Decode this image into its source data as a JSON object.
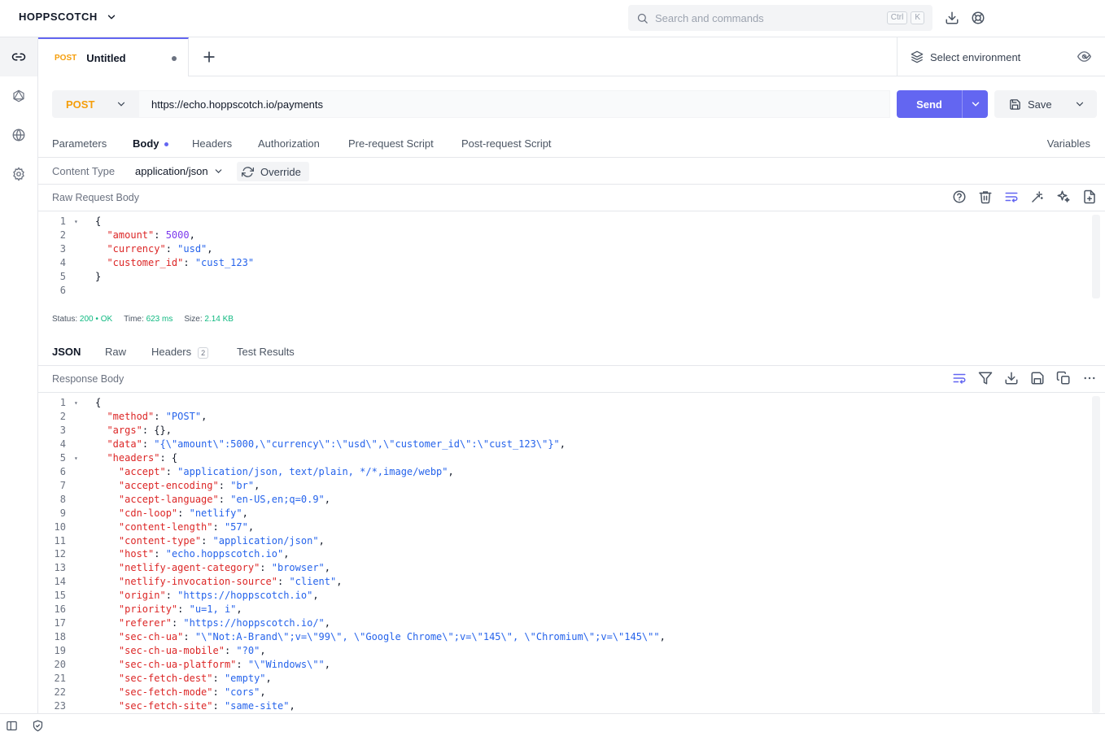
{
  "app": {
    "brand": "HOPPSCOTCH",
    "search_placeholder": "Search and commands",
    "search_shortcut": [
      "Ctrl",
      "K"
    ]
  },
  "tab": {
    "method": "POST",
    "title": "Untitled"
  },
  "environment": {
    "label": "Select environment"
  },
  "request": {
    "method": "POST",
    "url": "https://echo.hoppscotch.io/payments",
    "send_label": "Send",
    "save_label": "Save"
  },
  "request_tabs": [
    "Parameters",
    "Body",
    "Headers",
    "Authorization",
    "Pre-request Script",
    "Post-request Script"
  ],
  "variables_label": "Variables",
  "content_type": {
    "label": "Content Type",
    "value": "application/json",
    "override_label": "Override"
  },
  "raw_body": {
    "label": "Raw Request Body",
    "lines": [
      {
        "n": "1",
        "fold": true,
        "parts": [
          {
            "t": "{",
            "c": ""
          }
        ]
      },
      {
        "n": "2",
        "fold": false,
        "parts": [
          {
            "t": "  ",
            "c": ""
          },
          {
            "t": "\"amount\"",
            "c": "k"
          },
          {
            "t": ": ",
            "c": ""
          },
          {
            "t": "5000",
            "c": "n"
          },
          {
            "t": ",",
            "c": ""
          }
        ]
      },
      {
        "n": "3",
        "fold": false,
        "parts": [
          {
            "t": "  ",
            "c": ""
          },
          {
            "t": "\"currency\"",
            "c": "k"
          },
          {
            "t": ": ",
            "c": ""
          },
          {
            "t": "\"usd\"",
            "c": "s"
          },
          {
            "t": ",",
            "c": ""
          }
        ]
      },
      {
        "n": "4",
        "fold": false,
        "parts": [
          {
            "t": "  ",
            "c": ""
          },
          {
            "t": "\"customer_id\"",
            "c": "k"
          },
          {
            "t": ": ",
            "c": ""
          },
          {
            "t": "\"cust_123\"",
            "c": "s"
          }
        ]
      },
      {
        "n": "5",
        "fold": false,
        "parts": [
          {
            "t": "}",
            "c": ""
          }
        ]
      },
      {
        "n": "6",
        "fold": false,
        "parts": []
      }
    ]
  },
  "status": {
    "status_label": "Status:",
    "status_code": "200",
    "status_text": "OK",
    "time_label": "Time:",
    "time_value": "623 ms",
    "size_label": "Size:",
    "size_value": "2.14 KB"
  },
  "response_tabs": [
    {
      "label": "JSON",
      "badge": ""
    },
    {
      "label": "Raw",
      "badge": ""
    },
    {
      "label": "Headers",
      "badge": "2"
    },
    {
      "label": "Test Results",
      "badge": ""
    }
  ],
  "response_body": {
    "label": "Response Body",
    "lines": [
      {
        "n": "1",
        "fold": true,
        "parts": [
          {
            "t": "{",
            "c": ""
          }
        ]
      },
      {
        "n": "2",
        "fold": false,
        "parts": [
          {
            "t": "  ",
            "c": ""
          },
          {
            "t": "\"method\"",
            "c": "k"
          },
          {
            "t": ": ",
            "c": ""
          },
          {
            "t": "\"POST\"",
            "c": "s"
          },
          {
            "t": ",",
            "c": ""
          }
        ]
      },
      {
        "n": "3",
        "fold": false,
        "parts": [
          {
            "t": "  ",
            "c": ""
          },
          {
            "t": "\"args\"",
            "c": "k"
          },
          {
            "t": ": {},",
            "c": ""
          }
        ]
      },
      {
        "n": "4",
        "fold": false,
        "parts": [
          {
            "t": "  ",
            "c": ""
          },
          {
            "t": "\"data\"",
            "c": "k"
          },
          {
            "t": ": ",
            "c": ""
          },
          {
            "t": "\"{\\\"amount\\\":5000,\\\"currency\\\":\\\"usd\\\",\\\"customer_id\\\":\\\"cust_123\\\"}\"",
            "c": "s"
          },
          {
            "t": ",",
            "c": ""
          }
        ]
      },
      {
        "n": "5",
        "fold": true,
        "parts": [
          {
            "t": "  ",
            "c": ""
          },
          {
            "t": "\"headers\"",
            "c": "k"
          },
          {
            "t": ": {",
            "c": ""
          }
        ]
      },
      {
        "n": "6",
        "fold": false,
        "parts": [
          {
            "t": "    ",
            "c": ""
          },
          {
            "t": "\"accept\"",
            "c": "k"
          },
          {
            "t": ": ",
            "c": ""
          },
          {
            "t": "\"application/json, text/plain, */*,image/webp\"",
            "c": "s"
          },
          {
            "t": ",",
            "c": ""
          }
        ]
      },
      {
        "n": "7",
        "fold": false,
        "parts": [
          {
            "t": "    ",
            "c": ""
          },
          {
            "t": "\"accept-encoding\"",
            "c": "k"
          },
          {
            "t": ": ",
            "c": ""
          },
          {
            "t": "\"br\"",
            "c": "s"
          },
          {
            "t": ",",
            "c": ""
          }
        ]
      },
      {
        "n": "8",
        "fold": false,
        "parts": [
          {
            "t": "    ",
            "c": ""
          },
          {
            "t": "\"accept-language\"",
            "c": "k"
          },
          {
            "t": ": ",
            "c": ""
          },
          {
            "t": "\"en-US,en;q=0.9\"",
            "c": "s"
          },
          {
            "t": ",",
            "c": ""
          }
        ]
      },
      {
        "n": "9",
        "fold": false,
        "parts": [
          {
            "t": "    ",
            "c": ""
          },
          {
            "t": "\"cdn-loop\"",
            "c": "k"
          },
          {
            "t": ": ",
            "c": ""
          },
          {
            "t": "\"netlify\"",
            "c": "s"
          },
          {
            "t": ",",
            "c": ""
          }
        ]
      },
      {
        "n": "10",
        "fold": false,
        "parts": [
          {
            "t": "    ",
            "c": ""
          },
          {
            "t": "\"content-length\"",
            "c": "k"
          },
          {
            "t": ": ",
            "c": ""
          },
          {
            "t": "\"57\"",
            "c": "s"
          },
          {
            "t": ",",
            "c": ""
          }
        ]
      },
      {
        "n": "11",
        "fold": false,
        "parts": [
          {
            "t": "    ",
            "c": ""
          },
          {
            "t": "\"content-type\"",
            "c": "k"
          },
          {
            "t": ": ",
            "c": ""
          },
          {
            "t": "\"application/json\"",
            "c": "s"
          },
          {
            "t": ",",
            "c": ""
          }
        ]
      },
      {
        "n": "12",
        "fold": false,
        "parts": [
          {
            "t": "    ",
            "c": ""
          },
          {
            "t": "\"host\"",
            "c": "k"
          },
          {
            "t": ": ",
            "c": ""
          },
          {
            "t": "\"echo.hoppscotch.io\"",
            "c": "s"
          },
          {
            "t": ",",
            "c": ""
          }
        ]
      },
      {
        "n": "13",
        "fold": false,
        "parts": [
          {
            "t": "    ",
            "c": ""
          },
          {
            "t": "\"netlify-agent-category\"",
            "c": "k"
          },
          {
            "t": ": ",
            "c": ""
          },
          {
            "t": "\"browser\"",
            "c": "s"
          },
          {
            "t": ",",
            "c": ""
          }
        ]
      },
      {
        "n": "14",
        "fold": false,
        "parts": [
          {
            "t": "    ",
            "c": ""
          },
          {
            "t": "\"netlify-invocation-source\"",
            "c": "k"
          },
          {
            "t": ": ",
            "c": ""
          },
          {
            "t": "\"client\"",
            "c": "s"
          },
          {
            "t": ",",
            "c": ""
          }
        ]
      },
      {
        "n": "15",
        "fold": false,
        "parts": [
          {
            "t": "    ",
            "c": ""
          },
          {
            "t": "\"origin\"",
            "c": "k"
          },
          {
            "t": ": ",
            "c": ""
          },
          {
            "t": "\"https://hoppscotch.io\"",
            "c": "s"
          },
          {
            "t": ",",
            "c": ""
          }
        ]
      },
      {
        "n": "16",
        "fold": false,
        "parts": [
          {
            "t": "    ",
            "c": ""
          },
          {
            "t": "\"priority\"",
            "c": "k"
          },
          {
            "t": ": ",
            "c": ""
          },
          {
            "t": "\"u=1, i\"",
            "c": "s"
          },
          {
            "t": ",",
            "c": ""
          }
        ]
      },
      {
        "n": "17",
        "fold": false,
        "parts": [
          {
            "t": "    ",
            "c": ""
          },
          {
            "t": "\"referer\"",
            "c": "k"
          },
          {
            "t": ": ",
            "c": ""
          },
          {
            "t": "\"https://hoppscotch.io/\"",
            "c": "s"
          },
          {
            "t": ",",
            "c": ""
          }
        ]
      },
      {
        "n": "18",
        "fold": false,
        "parts": [
          {
            "t": "    ",
            "c": ""
          },
          {
            "t": "\"sec-ch-ua\"",
            "c": "k"
          },
          {
            "t": ": ",
            "c": ""
          },
          {
            "t": "\"\\\"Not:A-Brand\\\";v=\\\"99\\\", \\\"Google Chrome\\\";v=\\\"145\\\", \\\"Chromium\\\";v=\\\"145\\\"\"",
            "c": "s"
          },
          {
            "t": ",",
            "c": ""
          }
        ]
      },
      {
        "n": "19",
        "fold": false,
        "parts": [
          {
            "t": "    ",
            "c": ""
          },
          {
            "t": "\"sec-ch-ua-mobile\"",
            "c": "k"
          },
          {
            "t": ": ",
            "c": ""
          },
          {
            "t": "\"?0\"",
            "c": "s"
          },
          {
            "t": ",",
            "c": ""
          }
        ]
      },
      {
        "n": "20",
        "fold": false,
        "parts": [
          {
            "t": "    ",
            "c": ""
          },
          {
            "t": "\"sec-ch-ua-platform\"",
            "c": "k"
          },
          {
            "t": ": ",
            "c": ""
          },
          {
            "t": "\"\\\"Windows\\\"\"",
            "c": "s"
          },
          {
            "t": ",",
            "c": ""
          }
        ]
      },
      {
        "n": "21",
        "fold": false,
        "parts": [
          {
            "t": "    ",
            "c": ""
          },
          {
            "t": "\"sec-fetch-dest\"",
            "c": "k"
          },
          {
            "t": ": ",
            "c": ""
          },
          {
            "t": "\"empty\"",
            "c": "s"
          },
          {
            "t": ",",
            "c": ""
          }
        ]
      },
      {
        "n": "22",
        "fold": false,
        "parts": [
          {
            "t": "    ",
            "c": ""
          },
          {
            "t": "\"sec-fetch-mode\"",
            "c": "k"
          },
          {
            "t": ": ",
            "c": ""
          },
          {
            "t": "\"cors\"",
            "c": "s"
          },
          {
            "t": ",",
            "c": ""
          }
        ]
      },
      {
        "n": "23",
        "fold": false,
        "parts": [
          {
            "t": "    ",
            "c": ""
          },
          {
            "t": "\"sec-fetch-site\"",
            "c": "k"
          },
          {
            "t": ": ",
            "c": ""
          },
          {
            "t": "\"same-site\"",
            "c": "s"
          },
          {
            "t": ",",
            "c": ""
          }
        ]
      }
    ]
  },
  "colors": {
    "accent": "#6366f1",
    "method_post": "#f59e0b",
    "status_ok": "#10b981",
    "json_key": "#dc2626",
    "json_string": "#2563eb",
    "json_number": "#7c3aed"
  }
}
